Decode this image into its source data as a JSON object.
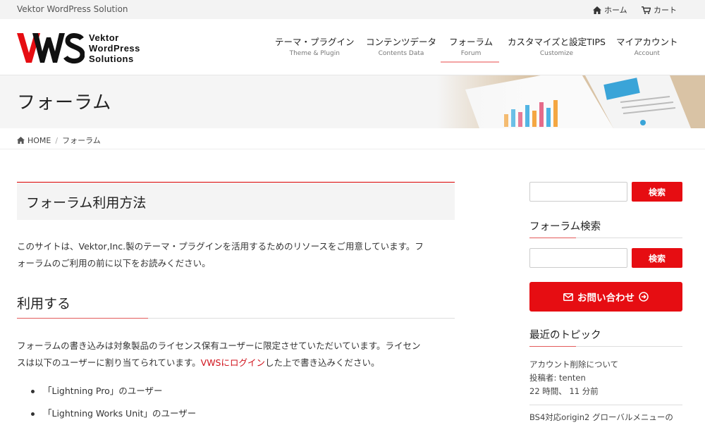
{
  "topbar": {
    "site_name": "Vektor WordPress Solution",
    "home_label": "ホーム",
    "cart_label": "カート"
  },
  "logo": {
    "mark_text": "VWS",
    "line1": "Vektor",
    "line2": "WordPress",
    "line3": "Solutions"
  },
  "nav": {
    "items": [
      {
        "jp": "テーマ・プラグイン",
        "en": "Theme & Plugin"
      },
      {
        "jp": "コンテンツデータ",
        "en": "Contents Data"
      },
      {
        "jp": "フォーラム",
        "en": "Forum"
      },
      {
        "jp": "カスタマイズと設定TIPS",
        "en": "Customize"
      },
      {
        "jp": "マイアカウント",
        "en": "Account"
      }
    ],
    "active": "フォーラム"
  },
  "page": {
    "title": "フォーラム"
  },
  "breadcrumb": {
    "home": "HOME",
    "current": "フォーラム"
  },
  "main": {
    "h2": "フォーラム利用方法",
    "intro_line1": "このサイトは、Vektor,Inc.製のテーマ・プラグインを活用するためのリソースをご用意しています。フ",
    "intro_line2": "ォーラムのご利用の前に以下をお読みください。",
    "h3": "利用する",
    "body_line1": "フォーラムの書き込みは対象製品のライセンス保有ユーザーに限定させていただいています。ライセン",
    "body_line2_pre": "スは以下のユーザーに割り当てられています。",
    "body_link": "VWSにログイン",
    "body_line2_post": "した上で書き込みください。",
    "list": [
      "「Lightning Pro」のユーザー",
      "「Lightning Works Unit」のユーザー"
    ]
  },
  "sidebar": {
    "search1": {
      "value": "",
      "button": "検索"
    },
    "forum_search_heading": "フォーラム検索",
    "search2": {
      "value": "",
      "button": "検索"
    },
    "contact_button": "お問い合わせ",
    "recent_heading": "最近のトピック",
    "topics": [
      {
        "title": "アカウント削除について",
        "author_label": "投稿者:",
        "author": "tenten",
        "time": "22 時間、 11 分前"
      },
      {
        "title": "BS4対応origin2 グローバルメニューの"
      }
    ]
  },
  "colors": {
    "accent": "#e60d12",
    "link": "#d0121b",
    "nav_underline": "#f4a3a3"
  }
}
